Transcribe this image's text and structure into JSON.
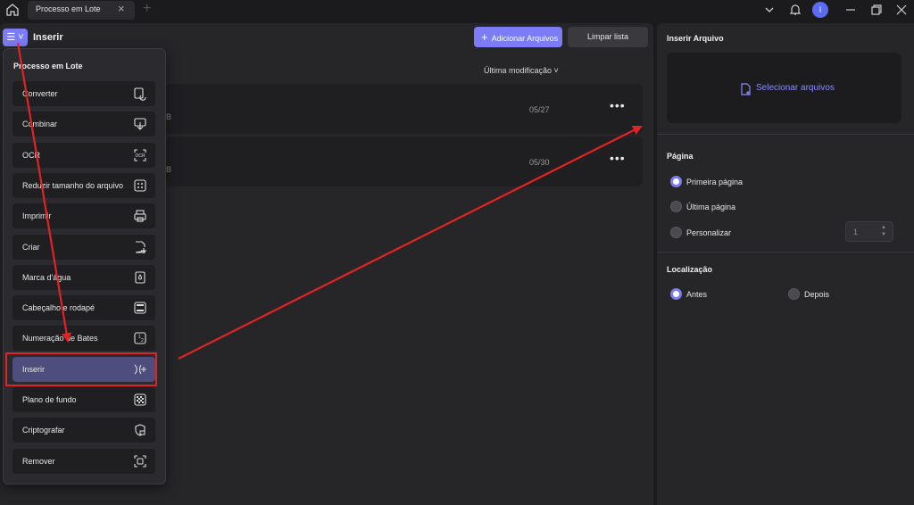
{
  "tab": {
    "label": "Processo em Lote",
    "close": "×",
    "new": "+"
  },
  "user": {
    "initial": "I"
  },
  "header": {
    "title": "Inserir",
    "menu_glyph": "☰ ˅",
    "add_button": "Adicionar Arquivos",
    "clear_button": "Limpar lista",
    "sort_label": "Última modificação ˅"
  },
  "files": [
    {
      "size": "B",
      "date": "05/27",
      "more": "•••"
    },
    {
      "size": "B",
      "date": "05/30",
      "more": "•••"
    }
  ],
  "menu": {
    "title": "Processo em Lote",
    "items": [
      {
        "label": "Converter",
        "icon": "convert-icon"
      },
      {
        "label": "Combinar",
        "icon": "combine-icon"
      },
      {
        "label": "OCR",
        "icon": "ocr-icon"
      },
      {
        "label": "Reduzir tamanho do arquivo",
        "icon": "compress-icon"
      },
      {
        "label": "Imprimir",
        "icon": "printer-icon"
      },
      {
        "label": "Criar",
        "icon": "create-icon"
      },
      {
        "label": "Marca d'água",
        "icon": "watermark-icon"
      },
      {
        "label": "Cabeçalho e rodapé",
        "icon": "header-footer-icon"
      },
      {
        "label": "Numeração de Bates",
        "icon": "bates-icon"
      },
      {
        "label": "Inserir",
        "icon": "insert-icon",
        "active": true
      },
      {
        "label": "Plano de fundo",
        "icon": "background-icon"
      },
      {
        "label": "Criptografar",
        "icon": "encrypt-icon"
      },
      {
        "label": "Remover",
        "icon": "remove-icon"
      }
    ]
  },
  "panel": {
    "title": "Inserir Arquivo",
    "select_files": "Selecionar arquivos",
    "page_section": "Página",
    "page_options": [
      "Primeira página",
      "Última página",
      "Personalizar"
    ],
    "page_selected": "Primeira página",
    "custom_value": "1",
    "location_section": "Localização",
    "location_options": [
      "Antes",
      "Depois"
    ],
    "location_selected": "Antes"
  },
  "colors": {
    "accent": "#7b7cf6",
    "annotation": "#e02424",
    "background": "#1b1b1e"
  }
}
